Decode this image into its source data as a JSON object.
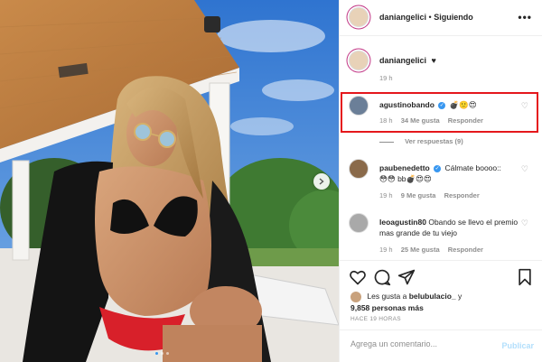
{
  "post": {
    "author": "daniangelici",
    "separator": "•",
    "follow_status": "Siguiendo",
    "more_label": "•••"
  },
  "caption": {
    "user": "daniangelici",
    "text": "♥",
    "time": "19 h"
  },
  "comments": [
    {
      "user": "agustinobando",
      "verified": true,
      "text": "💣🙂😍",
      "time": "18 h",
      "likes": "34 Me gusta",
      "reply": "Responder",
      "highlighted": true
    },
    {
      "user": "paubenedetto",
      "verified": true,
      "text": "Cálmate boooo::",
      "text2": "😳😳 bb💣😍😍",
      "time": "19 h",
      "likes": "9 Me gusta",
      "reply": "Responder"
    },
    {
      "user": "leoagustin80",
      "verified": false,
      "text": "Obando se llevo el premio mas grande de tu viejo",
      "time": "19 h",
      "likes": "25 Me gusta",
      "reply": "Responder"
    }
  ],
  "view_replies": "Ver respuestas (9)",
  "likes_line": {
    "prefix": "Les gusta a ",
    "user": "belubulacio_",
    "suffix": " y",
    "count": "9,858 personas más"
  },
  "post_time": "HACE 19 HORAS",
  "comment_box": {
    "placeholder": "Agrega un comentario...",
    "publish": "Publicar"
  },
  "icons": {
    "like": "heart-icon",
    "comment": "comment-icon",
    "share": "share-icon",
    "save": "bookmark-icon",
    "next": "chevron-right-icon"
  },
  "colors": {
    "highlight": "#e5171c",
    "verified": "#3897f0",
    "sky": "#3d86d8",
    "bikini_bottom": "#d8202a"
  }
}
